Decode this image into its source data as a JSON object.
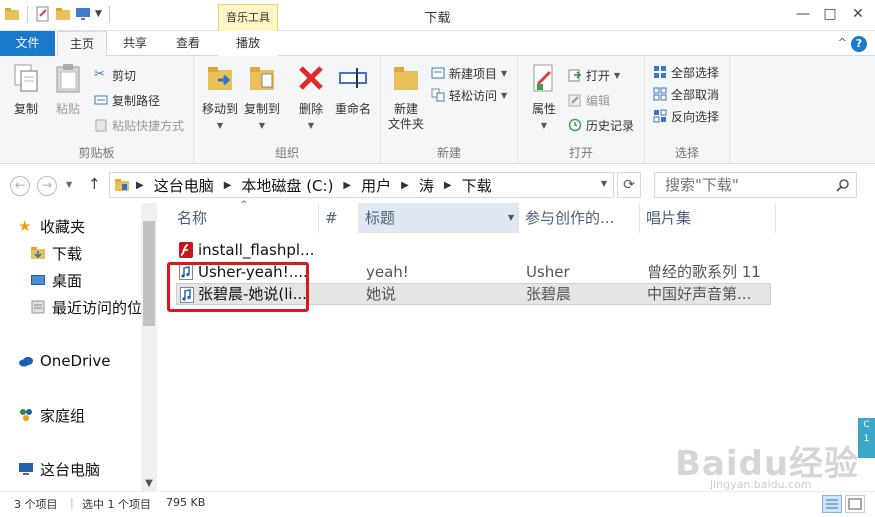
{
  "window": {
    "title": "下载",
    "contextual_tab_group": "音乐工具"
  },
  "tabs": {
    "file": "文件",
    "home": "主页",
    "share": "共享",
    "view": "查看",
    "play": "播放"
  },
  "ribbon": {
    "clipboard": {
      "label": "剪贴板",
      "copy": "复制",
      "paste": "粘贴",
      "cut": "剪切",
      "copy_path": "复制路径",
      "paste_shortcut": "粘贴快捷方式"
    },
    "organize": {
      "label": "组织",
      "move_to": "移动到",
      "copy_to": "复制到",
      "delete": "删除",
      "rename": "重命名"
    },
    "new": {
      "label": "新建",
      "new_folder_line1": "新建",
      "new_folder_line2": "文件夹",
      "new_item": "新建项目",
      "easy_access": "轻松访问"
    },
    "open": {
      "label": "打开",
      "properties": "属性",
      "open": "打开",
      "edit": "编辑",
      "history": "历史记录"
    },
    "select": {
      "label": "选择",
      "select_all": "全部选择",
      "select_none": "全部取消",
      "invert": "反向选择"
    }
  },
  "address": {
    "crumbs": [
      "这台电脑",
      "本地磁盘 (C:)",
      "用户",
      "涛",
      "下载"
    ],
    "search_placeholder": "搜索\"下载\""
  },
  "nav": {
    "favorites": "收藏夹",
    "downloads": "下载",
    "desktop": "桌面",
    "recent": "最近访问的位",
    "onedrive": "OneDrive",
    "homegroup": "家庭组",
    "thispc": "这台电脑"
  },
  "columns": {
    "name": "名称",
    "number": "#",
    "title": "标题",
    "artist": "参与创作的...",
    "album": "唱片集"
  },
  "files": [
    {
      "name": "install_flashpl...",
      "title": "",
      "artist": "",
      "album": "",
      "icon": "flash-installer-icon",
      "selected": false
    },
    {
      "name": "Usher-yeah!....",
      "title": "yeah!",
      "artist": "Usher",
      "album": "曾经的歌系列 11",
      "icon": "music-file-icon",
      "selected": false
    },
    {
      "name": "张碧晨-她说(li...",
      "title": "她说",
      "artist": "张碧晨",
      "album": "中国好声音第...",
      "icon": "music-file-icon",
      "selected": true
    }
  ],
  "status": {
    "item_count": "3 个项目",
    "selected": "选中 1 个项目",
    "size": "795 KB"
  },
  "side_tab": {
    "line1": "C",
    "line2": "1"
  },
  "watermark": {
    "main": "Baidu经验",
    "sub": "jingyan.baidu.com"
  },
  "colors": {
    "accent": "#1979ca",
    "highlight_box": "#e0161b",
    "context_tab_bg": "#fff6c8",
    "selected_row": "#e5e5e5"
  }
}
